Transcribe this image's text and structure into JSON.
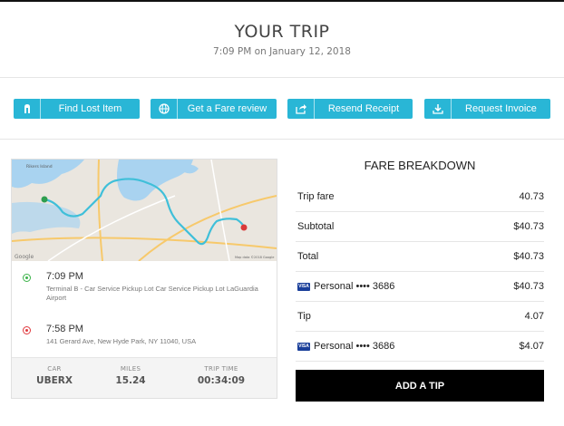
{
  "header": {
    "title": "YOUR TRIP",
    "subtitle": "7:09 PM on January 12, 2018"
  },
  "actions": [
    {
      "label": "Find Lost Item",
      "icon": "lost-item-icon"
    },
    {
      "label": "Get a Fare review",
      "icon": "globe-icon"
    },
    {
      "label": "Resend Receipt",
      "icon": "share-icon"
    },
    {
      "label": "Request Invoice",
      "icon": "download-icon"
    }
  ],
  "map": {
    "label_top": "Rikers Island",
    "copyright": "Map data ©2018 Google",
    "google": "Google"
  },
  "trip": {
    "pickup": {
      "time": "7:09 PM",
      "address": "Terminal B - Car Service Pickup Lot Car Service Pickup Lot LaGuardia Airport"
    },
    "dropoff": {
      "time": "7:58 PM",
      "address": "141 Gerard Ave, New Hyde Park, NY 11040, USA"
    },
    "stats": [
      {
        "label": "CAR",
        "value": "UBERX"
      },
      {
        "label": "MILES",
        "value": "15.24"
      },
      {
        "label": "TRIP TIME",
        "value": "00:34:09"
      }
    ]
  },
  "fare": {
    "title": "FARE BREAKDOWN",
    "rows": [
      {
        "label": "Trip fare",
        "value": "40.73"
      },
      {
        "label": "Subtotal",
        "value": "$40.73"
      },
      {
        "label": "Total",
        "value": "$40.73"
      },
      {
        "label": "Personal •••• 3686",
        "value": "$40.73",
        "card": "VISA"
      },
      {
        "label": "Tip",
        "value": "4.07"
      },
      {
        "label": "Personal •••• 3686",
        "value": "$4.07",
        "card": "VISA"
      }
    ],
    "tip_button": "ADD A TIP"
  },
  "colors": {
    "accent": "#29b6d6",
    "route": "#3fbfd9",
    "pickup": "#3cb34a",
    "dropoff": "#e0393e",
    "water": "#a9d3f0"
  }
}
